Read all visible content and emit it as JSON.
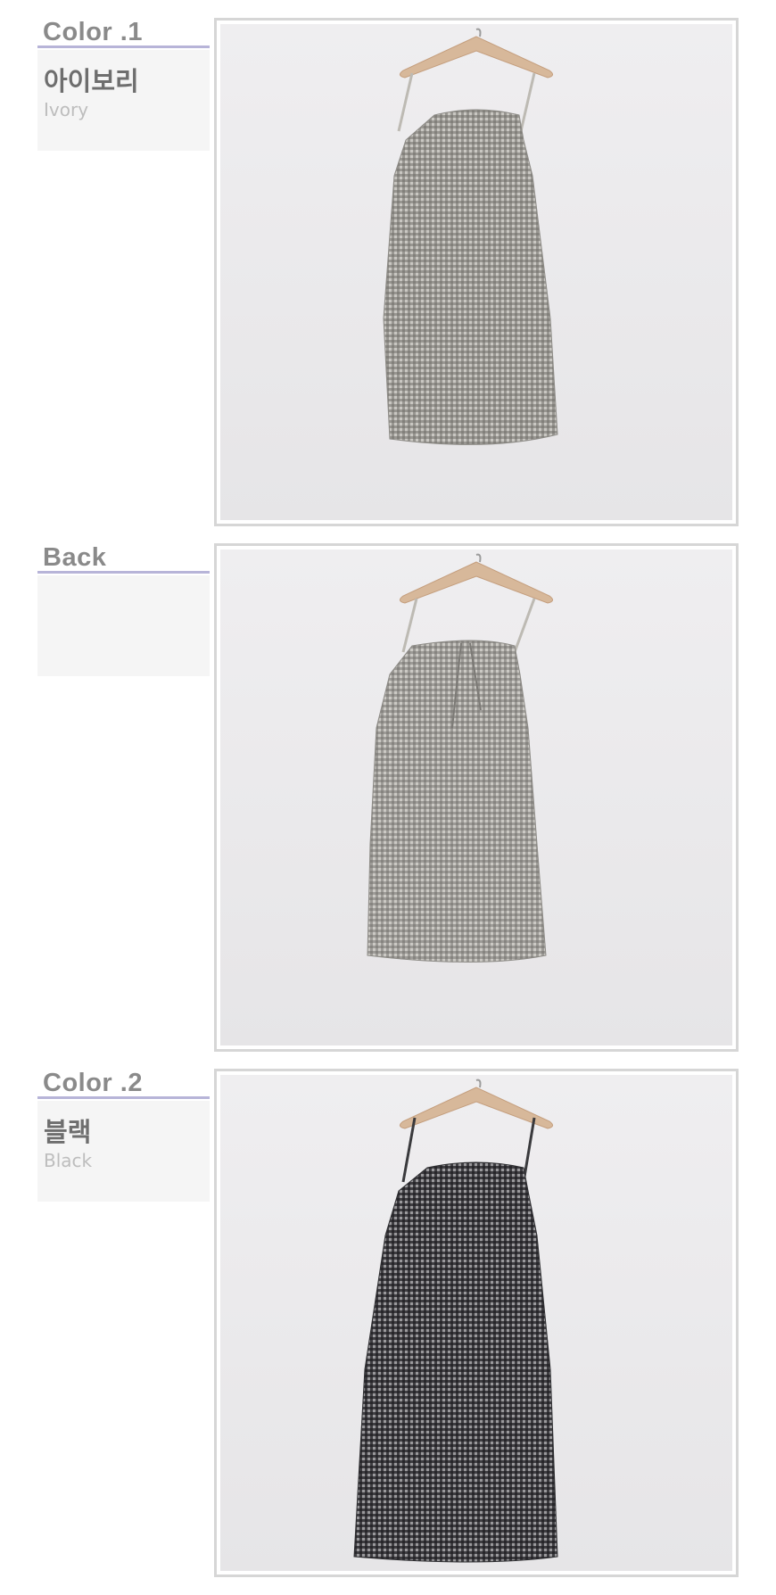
{
  "sections": [
    {
      "title": "Color .1",
      "name_ko": "아이보리",
      "name_en": "Ivory"
    },
    {
      "title": "Back",
      "name_ko": "",
      "name_en": ""
    },
    {
      "title": "Color .2",
      "name_ko": "블랙",
      "name_en": "Black"
    }
  ],
  "colors": {
    "accent_line": "#b7b4d8",
    "label_bg": "#f5f5f5",
    "dress_ivory": "#8d8b86",
    "dress_black": "#3a3a3d",
    "hanger": "#d7b89a"
  },
  "icons": [
    "hanger-icon",
    "dress-image"
  ]
}
